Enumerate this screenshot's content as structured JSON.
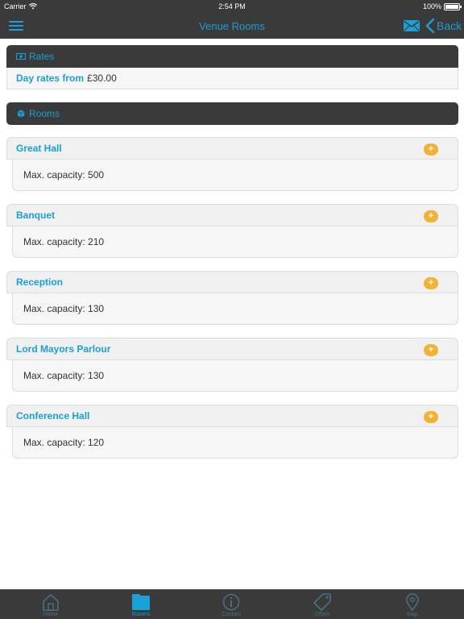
{
  "status_bar": {
    "carrier": "Carrier",
    "time": "2:54 PM",
    "battery": "100%"
  },
  "nav": {
    "title": "Venue Rooms",
    "back_label": "Back",
    "icons": [
      "menu-icon",
      "mail-icon",
      "back-chevron-icon"
    ]
  },
  "rates": {
    "header": "Rates",
    "label": "Day rates from",
    "value": "£30.00"
  },
  "rooms_section": {
    "header": "Rooms"
  },
  "rooms": [
    {
      "name": "Great Hall",
      "capacity": "Max. capacity: 500",
      "toggle": "+"
    },
    {
      "name": "Banquet",
      "capacity": "Max. capacity: 210",
      "toggle": "+"
    },
    {
      "name": "Reception",
      "capacity": "Max. capacity: 130",
      "toggle": "+"
    },
    {
      "name": "Lord Mayors Parlour",
      "capacity": "Max. capacity: 130",
      "toggle": "+"
    },
    {
      "name": "Conference Hall",
      "capacity": "Max. capacity: 120",
      "toggle": "+"
    }
  ],
  "tabs": [
    {
      "label": "Home",
      "icon": "home-icon",
      "active": false
    },
    {
      "label": "Rooms",
      "icon": "rooms-icon",
      "active": true
    },
    {
      "label": "Contact",
      "icon": "info-icon",
      "active": false
    },
    {
      "label": "Offers",
      "icon": "tag-icon",
      "active": false
    },
    {
      "label": "Map",
      "icon": "map-pin-icon",
      "active": false
    }
  ],
  "colors": {
    "accent": "#1a9fd6",
    "bar_background": "#3a3a3a",
    "plus_button": "#f2b233",
    "tab_inactive": "#4a6e80"
  }
}
